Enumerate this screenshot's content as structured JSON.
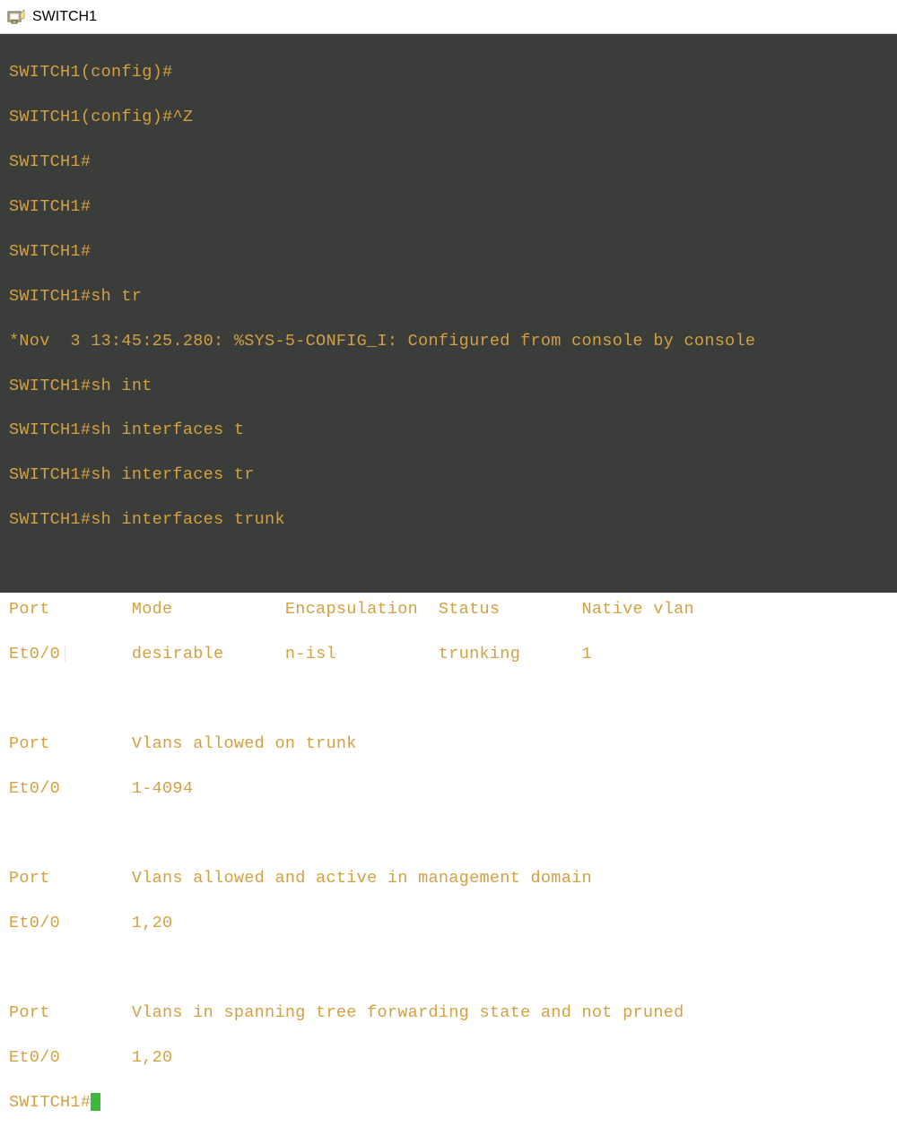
{
  "window": {
    "title": "SWITCH1"
  },
  "colors": {
    "terminal_bg": "#3a3d3a",
    "text": "#d4a040",
    "cursor": "#3db83d"
  },
  "lines": {
    "l0p": "SWITCH1(config)#",
    "l1p": "SWITCH1(config)#",
    "l1i": "^Z",
    "l2p": "SWITCH1#",
    "l3p": "SWITCH1#",
    "l4p": "SWITCH1#",
    "l5p": "SWITCH1#",
    "l5i": "sh tr",
    "l6": "*Nov  3 13:45:25.280: %SYS-5-CONFIG_I: Configured from console by console",
    "l7p": "SWITCH1#",
    "l7i": "sh int",
    "l8p": "SWITCH1#",
    "l8i": "sh interfaces t",
    "l9p": "SWITCH1#",
    "l9i": "sh interfaces tr",
    "l10p": "SWITCH1#",
    "l10i": "sh interfaces trunk"
  },
  "tables": {
    "t1": {
      "header": "Port        Mode           Encapsulation  Status        Native vlan",
      "row": "Et0/0       desirable      n-isl          trunking      1"
    },
    "t2": {
      "header": "Port        Vlans allowed on trunk",
      "row": "Et0/0       1-4094"
    },
    "t3": {
      "header": "Port        Vlans allowed and active in management domain",
      "row": "Et0/0       1,20"
    },
    "t4": {
      "header": "Port        Vlans in spanning tree forwarding state and not pruned",
      "row": "Et0/0       1,20"
    }
  },
  "final_prompt": "SWITCH1#",
  "chart_data": {
    "type": "table",
    "title": "sh interfaces trunk",
    "sections": [
      {
        "columns": [
          "Port",
          "Mode",
          "Encapsulation",
          "Status",
          "Native vlan"
        ],
        "rows": [
          [
            "Et0/0",
            "desirable",
            "n-isl",
            "trunking",
            "1"
          ]
        ]
      },
      {
        "columns": [
          "Port",
          "Vlans allowed on trunk"
        ],
        "rows": [
          [
            "Et0/0",
            "1-4094"
          ]
        ]
      },
      {
        "columns": [
          "Port",
          "Vlans allowed and active in management domain"
        ],
        "rows": [
          [
            "Et0/0",
            "1,20"
          ]
        ]
      },
      {
        "columns": [
          "Port",
          "Vlans in spanning tree forwarding state and not pruned"
        ],
        "rows": [
          [
            "Et0/0",
            "1,20"
          ]
        ]
      }
    ]
  }
}
